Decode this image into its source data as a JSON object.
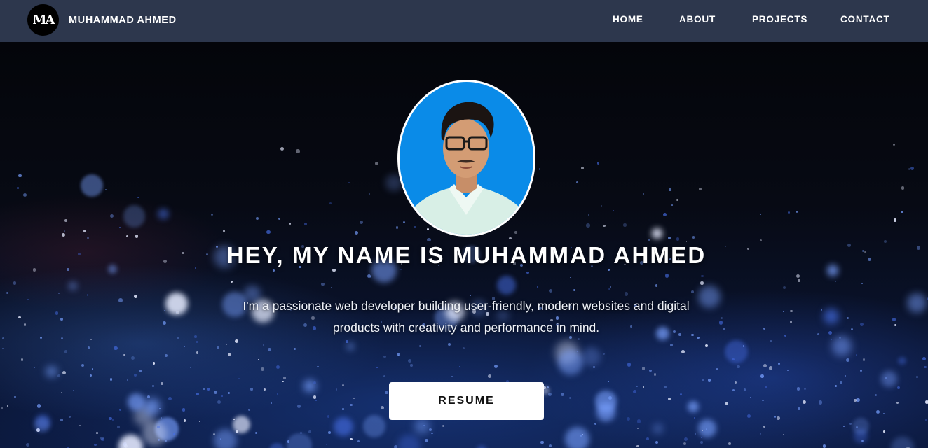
{
  "navbar": {
    "logo_text": "MA",
    "brand_name": "MUHAMMAD AHMED",
    "links": [
      {
        "label": "HOME"
      },
      {
        "label": "ABOUT"
      },
      {
        "label": "PROJECTS"
      },
      {
        "label": "CONTACT"
      }
    ],
    "background": "#2d374d"
  },
  "hero": {
    "title": "HEY, MY NAME IS MUHAMMAD AHMED",
    "description": "I'm a passionate web developer building user-friendly, modern websites and digital products with creativity and performance in mind.",
    "button_label": "RESUME",
    "avatar_background": "#0a8be8"
  }
}
